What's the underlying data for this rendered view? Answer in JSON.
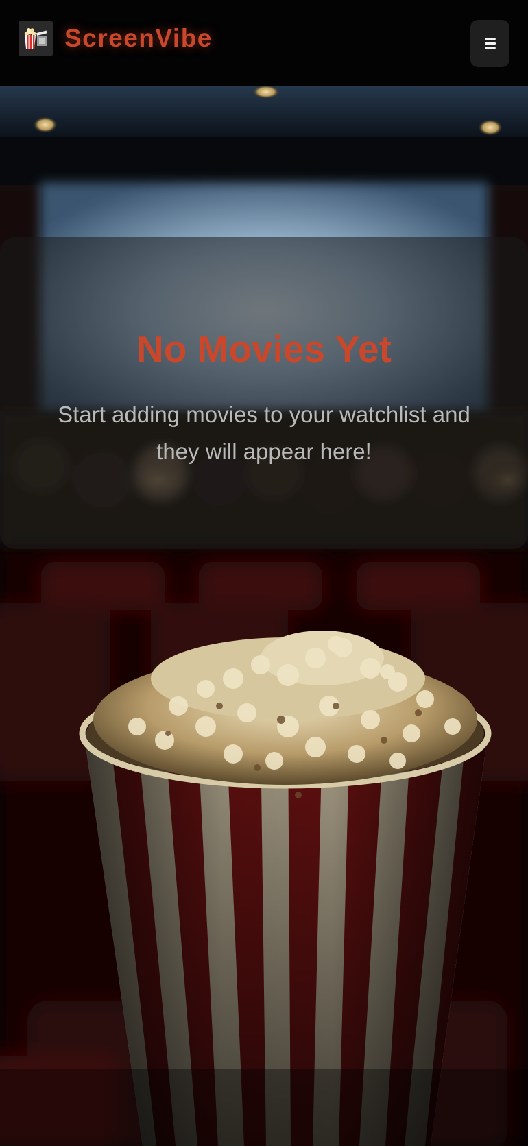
{
  "header": {
    "brand": "ScreenVibe",
    "logo_icon": "popcorn-clapperboard-icon",
    "menu_icon": "hamburger-menu-icon"
  },
  "empty_state": {
    "title": "No Movies Yet",
    "message": "Start adding movies to your watchlist and they will appear here!"
  },
  "background": {
    "scene": "cinema-theater-popcorn-background"
  },
  "colors": {
    "accent": "#c9472a",
    "header_bg": "#030303",
    "text_muted": "#b9b9b9"
  }
}
